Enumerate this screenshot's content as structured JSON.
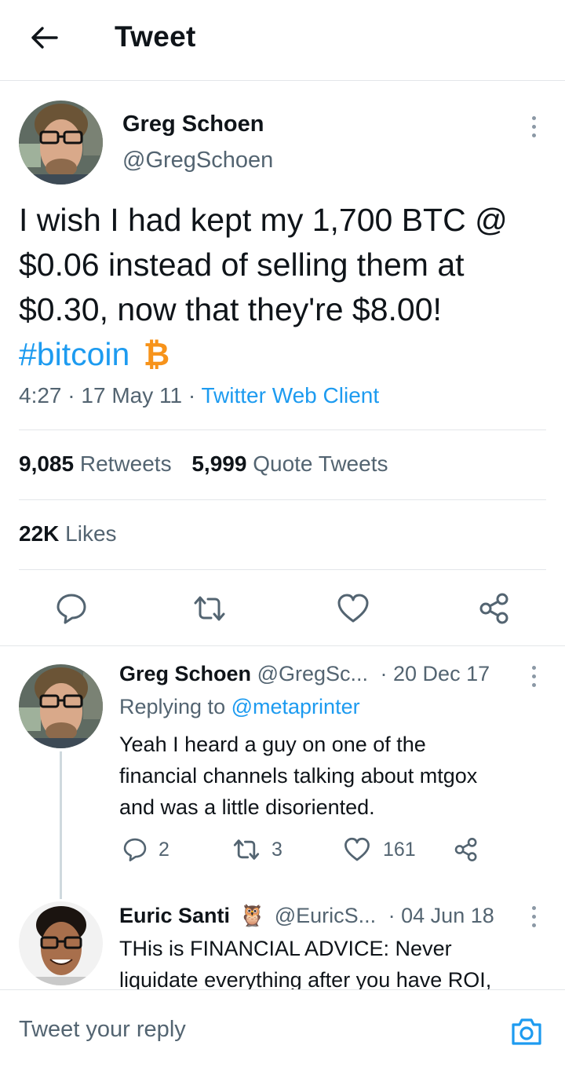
{
  "header": {
    "title": "Tweet"
  },
  "tweet": {
    "author_name": "Greg Schoen",
    "author_handle": "@GregSchoen",
    "text_lines": [
      "I wish I had kept my 1,700 BTC @",
      "$0.06 instead of selling them at",
      "$0.30, now that they're $8.00!"
    ],
    "hashtag": "#bitcoin",
    "hashtag_emoji": "₿",
    "time": "4:27",
    "date": "17 May 11",
    "separator": "·",
    "client": "Twitter Web Client",
    "retweets_count": "9,085",
    "retweets_label": "Retweets",
    "quotes_count": "5,999",
    "quotes_label": "Quote Tweets",
    "likes_count": "22K",
    "likes_label": "Likes"
  },
  "replies": [
    {
      "author_name": "Greg Schoen",
      "author_handle": "@GregSc...",
      "date": "· 20 Dec 17",
      "replying_prefix": "Replying to",
      "replying_to": "@metaprinter",
      "text_lines": [
        "Yeah I heard a guy on one of the",
        "financial channels talking about mtgox",
        "and was a little disoriented."
      ],
      "reply_count": "2",
      "retweet_count": "3",
      "like_count": "161"
    },
    {
      "author_name": "Euric Santi",
      "author_emoji": "🦉",
      "author_handle": "@EuricS...",
      "date": "· 04 Jun 18",
      "text_lines": [
        "THis is FINANCIAL ADVICE: Never",
        "liquidate everything after you have ROI,"
      ]
    }
  ],
  "reply_bar": {
    "placeholder": "Tweet your reply"
  },
  "colors": {
    "accent": "#1d9bf0",
    "muted": "#536471",
    "bitcoin": "#f7931a",
    "divider": "#e3e6e9"
  }
}
